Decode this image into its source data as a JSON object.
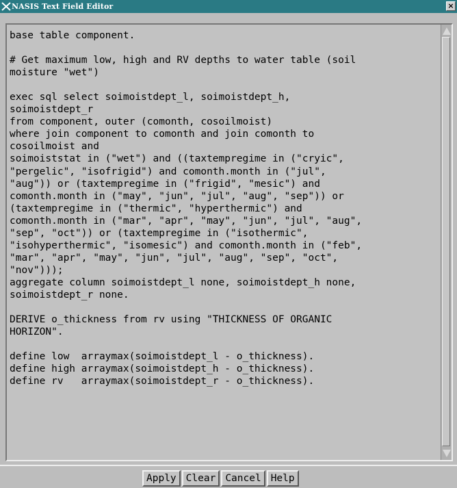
{
  "window": {
    "title": "NASIS Text Field Editor",
    "icon": "nasis-x-icon",
    "close_glyph": "×"
  },
  "editor": {
    "text": "base table component.\n\n# Get maximum low, high and RV depths to water table (soil\nmoisture \"wet\")\n\nexec sql select soimoistdept_l, soimoistdept_h,\nsoimoistdept_r\nfrom component, outer (comonth, cosoilmoist)\nwhere join component to comonth and join comonth to\ncosoilmoist and\nsoimoiststat in (\"wet\") and ((taxtempregime in (\"cryic\",\n\"pergelic\", \"isofrigid\") and comonth.month in (\"jul\",\n\"aug\")) or (taxtempregime in (\"frigid\", \"mesic\") and\ncomonth.month in (\"may\", \"jun\", \"jul\", \"aug\", \"sep\")) or\n(taxtempregime in (\"thermic\", \"hyperthermic\") and\ncomonth.month in (\"mar\", \"apr\", \"may\", \"jun\", \"jul\", \"aug\",\n\"sep\", \"oct\")) or (taxtempregime in (\"isothermic\",\n\"isohyperthermic\", \"isomesic\") and comonth.month in (\"feb\",\n\"mar\", \"apr\", \"may\", \"jun\", \"jul\", \"aug\", \"sep\", \"oct\",\n\"nov\")));\naggregate column soimoistdept_l none, soimoistdept_h none,\nsoimoistdept_r none.\n\nDERIVE o_thickness from rv using \"THICKNESS OF ORGANIC\nHORIZON\".\n\ndefine low  arraymax(soimoistdept_l - o_thickness).\ndefine high arraymax(soimoistdept_h - o_thickness).\ndefine rv   arraymax(soimoistdept_r - o_thickness)."
  },
  "buttons": {
    "apply": "Apply",
    "clear": "Clear",
    "cancel": "Cancel",
    "help": "Help"
  },
  "colors": {
    "titlebar": "#2a7a84",
    "background": "#bdbdbd"
  }
}
